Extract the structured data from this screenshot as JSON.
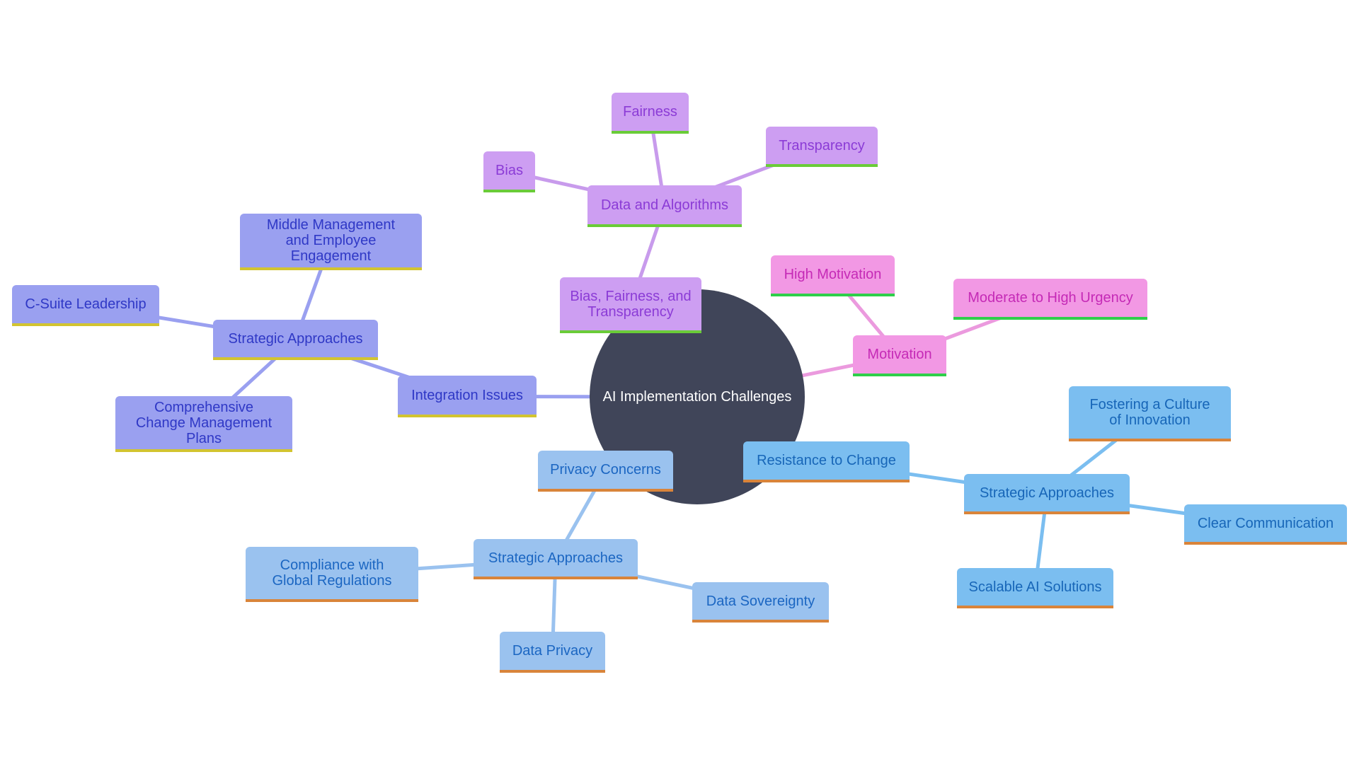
{
  "diagram": {
    "type": "mindmap",
    "root": "AI Implementation Challenges",
    "colors": {
      "root": "#404559",
      "purple": "#cd9ef2",
      "pink": "#f298e4",
      "indigo": "#9aa0f0",
      "privacy_blue": "#9ac2ef",
      "sky_blue": "#7bbef0"
    },
    "nodes": {
      "bft": "Bias, Fairness, and Transparency",
      "data_algorithms": "Data and Algorithms",
      "bias": "Bias",
      "fairness": "Fairness",
      "transparency": "Transparency",
      "motivation": "Motivation",
      "high_motivation": "High Motivation",
      "urgency": "Moderate to High Urgency",
      "integration": "Integration Issues",
      "strategic_left": "Strategic Approaches",
      "middle_mgmt": "Middle Management and Employee Engagement",
      "csuite": "C-Suite Leadership",
      "comprehensive": "Comprehensive Change Management Plans",
      "privacy": "Privacy Concerns",
      "strategic_bottom": "Strategic Approaches",
      "compliance": "Compliance with Global Regulations",
      "sovereignty": "Data Sovereignty",
      "data_privacy": "Data Privacy",
      "resistance": "Resistance to Change",
      "strategic_right": "Strategic Approaches",
      "fostering": "Fostering a Culture of Innovation",
      "clear_comm": "Clear Communication",
      "scalable": "Scalable AI Solutions"
    },
    "edges": [
      [
        "root",
        "bft"
      ],
      [
        "bft",
        "data_algorithms"
      ],
      [
        "data_algorithms",
        "bias"
      ],
      [
        "data_algorithms",
        "fairness"
      ],
      [
        "data_algorithms",
        "transparency"
      ],
      [
        "root",
        "motivation"
      ],
      [
        "motivation",
        "high_motivation"
      ],
      [
        "motivation",
        "urgency"
      ],
      [
        "root",
        "integration"
      ],
      [
        "integration",
        "strategic_left"
      ],
      [
        "strategic_left",
        "middle_mgmt"
      ],
      [
        "strategic_left",
        "csuite"
      ],
      [
        "strategic_left",
        "comprehensive"
      ],
      [
        "root",
        "privacy"
      ],
      [
        "privacy",
        "strategic_bottom"
      ],
      [
        "strategic_bottom",
        "compliance"
      ],
      [
        "strategic_bottom",
        "sovereignty"
      ],
      [
        "strategic_bottom",
        "data_privacy"
      ],
      [
        "root",
        "resistance"
      ],
      [
        "resistance",
        "strategic_right"
      ],
      [
        "strategic_right",
        "fostering"
      ],
      [
        "strategic_right",
        "clear_comm"
      ],
      [
        "strategic_right",
        "scalable"
      ]
    ]
  }
}
